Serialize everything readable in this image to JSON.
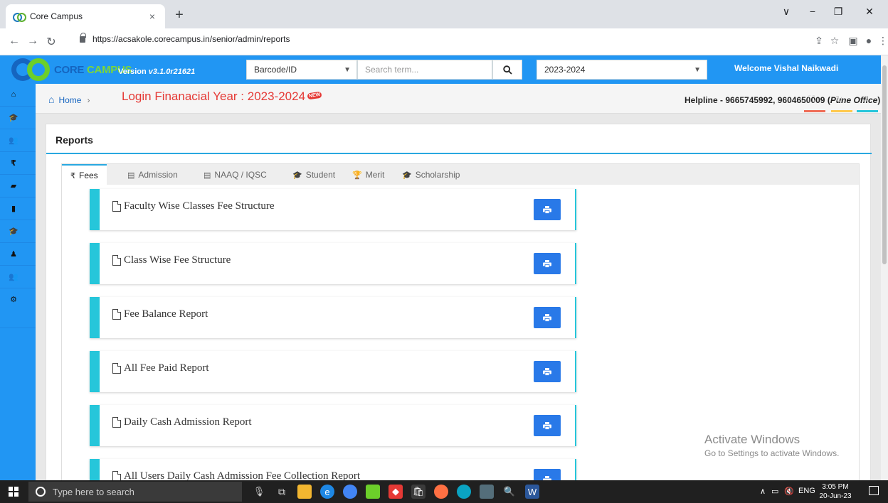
{
  "browser": {
    "tab_title": "Core Campus",
    "tab_close": "×",
    "new_tab": "+",
    "url": "https://acsakole.corecampus.in/senior/admin/reports",
    "win_controls": [
      "∨",
      "−",
      "❐",
      "✕"
    ]
  },
  "header": {
    "brand_core": "CORE ",
    "brand_campus": "CAMPUS",
    "version_label": "Version ",
    "version_value": "v3.1.0r21621",
    "lookup_select": "Barcode/ID",
    "search_placeholder": "Search term...",
    "year_select": "2023-2024",
    "welcome": "Welcome Vishal Naikwadi"
  },
  "sidebar": {
    "icons": [
      "home-icon",
      "graduation-cap-icon",
      "users-icon",
      "rupee-icon",
      "book-icon",
      "file-icon",
      "graduation-cap-icon",
      "user-icon",
      "users-icon",
      "cogs-icon"
    ],
    "glyphs": [
      "⌂",
      "🎓",
      "👥",
      "₹",
      "▰",
      "▮",
      "🎓",
      "♟",
      "👥",
      "⚙"
    ]
  },
  "breadcrumb": {
    "home": "Home",
    "separator": "›",
    "financial_year": "Login Finanacial Year : 2023-2024",
    "new_badge": "NEW",
    "helpline_prefix": "Helpline - 9665745992, 9604650009 (",
    "helpline_office": "Pune Office",
    "helpline_suffix": ")",
    "controls": [
      {
        "icon": "expand-icon",
        "glyph": "⛶",
        "color": "#ef6c57"
      },
      {
        "icon": "refresh-icon",
        "glyph": "↻",
        "color": "#ffc94d"
      },
      {
        "icon": "arrows-h-icon",
        "glyph": "↔",
        "color": "#26c6da"
      }
    ]
  },
  "reports": {
    "title": "Reports",
    "tabs": [
      {
        "label": "Fees",
        "icon": "₹"
      },
      {
        "label": "Admission",
        "icon": "▤"
      },
      {
        "label": "NAAQ / IQSC",
        "icon": "▤"
      },
      {
        "label": "Student",
        "icon": "🎓"
      },
      {
        "label": "Merit",
        "icon": "🏆"
      },
      {
        "label": "Scholarship",
        "icon": "🎓"
      }
    ],
    "items": [
      "Faculty Wise Classes Fee Structure",
      "Class Wise Fee Structure",
      "Fee Balance Report",
      "All Fee Paid Report",
      "Daily Cash Admission Report",
      "All Users Daily Cash Admission Fee Collection Report"
    ]
  },
  "watermark": {
    "line1": "Activate Windows",
    "line2": "Go to Settings to activate Windows."
  },
  "taskbar": {
    "search_placeholder": "Type here to search",
    "lang": "ENG",
    "time": "3:05 PM",
    "date": "20-Jun-23"
  },
  "colors": {
    "header_blue": "#2196f3",
    "accent_cyan": "#26c6da",
    "print_button": "#2979e8",
    "fy_red": "#e53935"
  }
}
